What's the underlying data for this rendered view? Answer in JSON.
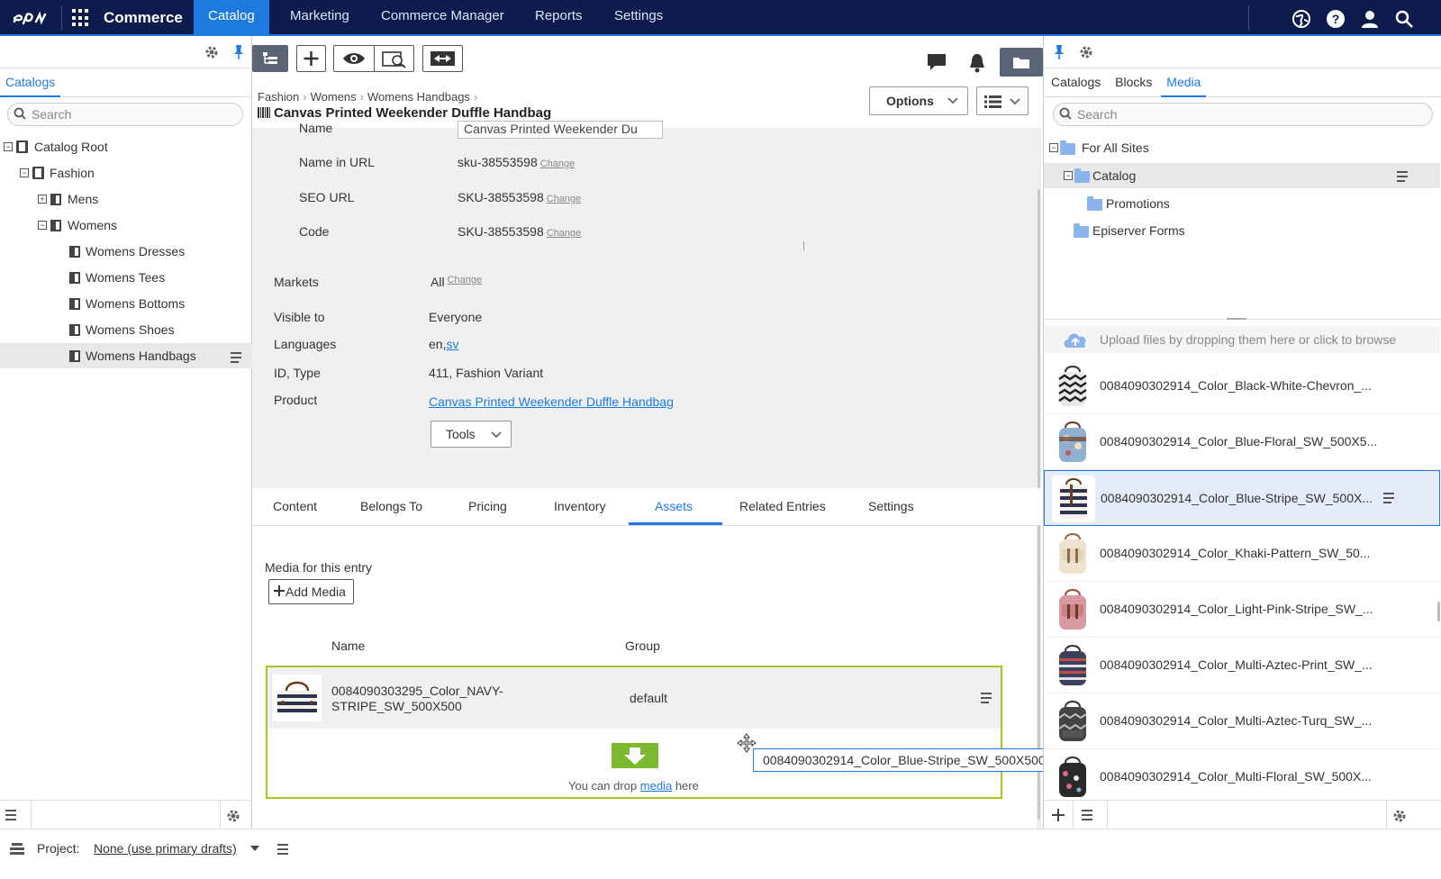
{
  "topnav": {
    "product": "Commerce",
    "items": [
      "Catalog",
      "Marketing",
      "Commerce Manager",
      "Reports",
      "Settings"
    ]
  },
  "left": {
    "tab": "Catalogs",
    "search_placeholder": "Search",
    "tree": [
      {
        "label": "Catalog Root"
      },
      {
        "label": "Fashion"
      },
      {
        "label": "Mens"
      },
      {
        "label": "Womens"
      },
      {
        "label": "Womens Dresses"
      },
      {
        "label": "Womens Tees"
      },
      {
        "label": "Womens Bottoms"
      },
      {
        "label": "Womens Shoes"
      },
      {
        "label": "Womens Handbags"
      }
    ]
  },
  "center": {
    "breadcrumb": [
      "Fashion",
      "Womens",
      "Womens Handbags"
    ],
    "title": "Canvas Printed Weekender Duffle Handbag",
    "options_label": "Options",
    "fields": {
      "name_label": "Name",
      "name_value": "Canvas Printed Weekender Du",
      "name_in_url_label": "Name in URL",
      "name_in_url_value": "sku-38553598",
      "seo_url_label": "SEO URL",
      "seo_url_value": "SKU-38553598",
      "code_label": "Code",
      "code_value": "SKU-38553598",
      "change": "Change",
      "markets_label": "Markets",
      "markets_value": "All",
      "visible_label": "Visible to",
      "visible_value": "Everyone",
      "languages_label": "Languages",
      "lang_en": "en,",
      "lang_sv": "sv",
      "idtype_label": "ID, Type",
      "idtype_value": "411, Fashion Variant",
      "product_label": "Product",
      "product_value": "Canvas Printed Weekender Duffle Handbag",
      "tools_label": "Tools"
    },
    "tabs": [
      "Content",
      "Belongs To",
      "Pricing",
      "Inventory",
      "Assets",
      "Related Entries",
      "Settings"
    ],
    "active_tab": "Assets",
    "assets": {
      "media_label": "Media for this entry",
      "add_media": "Add Media",
      "col_name": "Name",
      "col_group": "Group",
      "row_name_1": "0084090303295_Color_NAVY-",
      "row_name_2": "STRIPE_SW_500X500",
      "row_group": "default",
      "drop_prefix": "You can drop",
      "drop_link": "media",
      "drop_suffix": "here",
      "drag_tooltip": "0084090302914_Color_Blue-Stripe_SW_500X500"
    }
  },
  "right": {
    "tabs": [
      "Catalogs",
      "Blocks",
      "Media"
    ],
    "active_tab": "Media",
    "search_placeholder": "Search",
    "folders": [
      "For All Sites",
      "Catalog",
      "Promotions",
      "Episerver Forms"
    ],
    "upload_text": "Upload files by dropping them here or click to browse",
    "media": [
      {
        "name": "0084090302914_Color_Black-White-Chevron_..."
      },
      {
        "name": "0084090302914_Color_Blue-Floral_SW_500X5..."
      },
      {
        "name": "0084090302914_Color_Blue-Stripe_SW_500X..."
      },
      {
        "name": "0084090302914_Color_Khaki-Pattern_SW_50..."
      },
      {
        "name": "0084090302914_Color_Light-Pink-Stripe_SW_..."
      },
      {
        "name": "0084090302914_Color_Multi-Aztec-Print_SW_..."
      },
      {
        "name": "0084090302914_Color_Multi-Aztec-Turq_SW_..."
      },
      {
        "name": "0084090302914_Color_Multi-Floral_SW_500X..."
      }
    ]
  },
  "footer": {
    "project_label": "Project:",
    "project_value": "None (use primary drafts)"
  },
  "colors": {
    "nav_bg": "#0d1b4d",
    "accent": "#1f7ae0",
    "drop_border": "#a8c320",
    "drop_arrow": "#7db92e"
  }
}
